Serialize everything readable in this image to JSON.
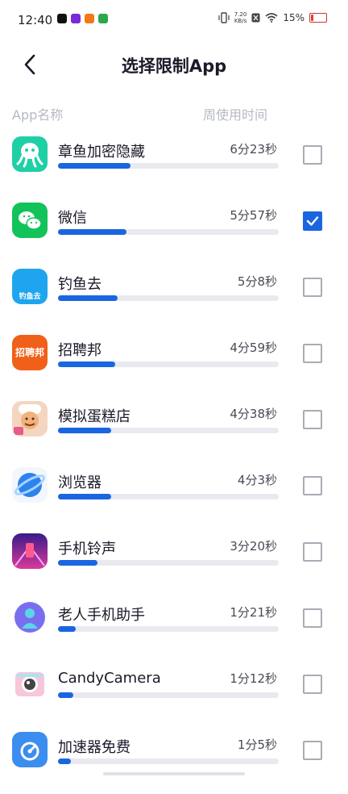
{
  "status_bar": {
    "time": "12:40",
    "net_speed_value": "7.20",
    "net_speed_unit": "KB/s",
    "battery_percent": "15%",
    "battery_level": 0.15
  },
  "header": {
    "title": "选择限制App"
  },
  "columns": {
    "name": "App名称",
    "time": "周使用时间"
  },
  "apps": [
    {
      "name": "章鱼加密隐藏",
      "time": "6分23秒",
      "usage": 0.33,
      "checked": false,
      "icon": "octopus-icon",
      "color": "#1fd0a6"
    },
    {
      "name": "微信",
      "time": "5分57秒",
      "usage": 0.31,
      "checked": true,
      "icon": "wechat-icon",
      "color": "#12c35a"
    },
    {
      "name": "钓鱼去",
      "time": "5分8秒",
      "usage": 0.27,
      "checked": false,
      "icon": "fishing-icon",
      "color": "#1fa5f0",
      "icon_text": "钓鱼去"
    },
    {
      "name": "招聘邦",
      "time": "4分59秒",
      "usage": 0.26,
      "checked": false,
      "icon": "recruit-icon",
      "color": "#f06018",
      "icon_text": "招聘邦"
    },
    {
      "name": "模拟蛋糕店",
      "time": "4分38秒",
      "usage": 0.24,
      "checked": false,
      "icon": "cake-shop-icon",
      "color": "#e85a8a"
    },
    {
      "name": "浏览器",
      "time": "4分3秒",
      "usage": 0.24,
      "checked": false,
      "icon": "browser-icon",
      "color": "#2d82f0"
    },
    {
      "name": "手机铃声",
      "time": "3分20秒",
      "usage": 0.18,
      "checked": false,
      "icon": "ringtone-icon",
      "color": "#7a2ad8"
    },
    {
      "name": "老人手机助手",
      "time": "1分21秒",
      "usage": 0.08,
      "checked": false,
      "icon": "elder-helper-icon",
      "color": "#7a6ef0"
    },
    {
      "name": "CandyCamera",
      "time": "1分12秒",
      "usage": 0.07,
      "checked": false,
      "icon": "camera-icon",
      "color": "#f7a6c6"
    },
    {
      "name": "加速器免费",
      "time": "1分5秒",
      "usage": 0.06,
      "checked": false,
      "icon": "accelerator-icon",
      "color": "#3b8ef0"
    }
  ]
}
